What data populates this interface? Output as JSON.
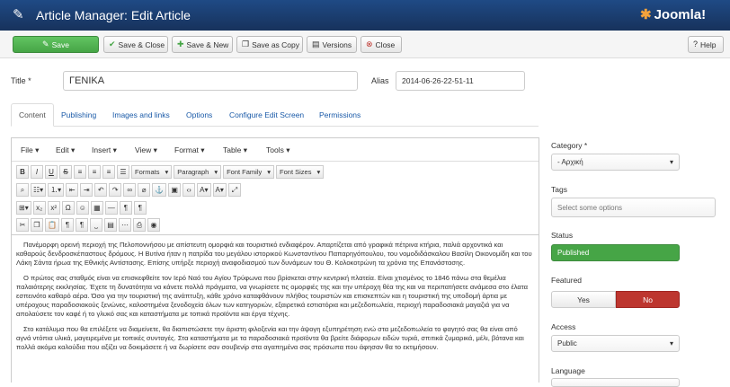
{
  "header": {
    "title": "Article Manager: Edit Article",
    "brand": "Joomla!"
  },
  "toolbar": {
    "save": "Save",
    "save_close": "Save & Close",
    "save_new": "Save & New",
    "save_copy": "Save as Copy",
    "versions": "Versions",
    "close": "Close",
    "help": "Help"
  },
  "form": {
    "title_label": "Title *",
    "title_value": "ΓΕΝΙΚΑ",
    "alias_label": "Alias",
    "alias_value": "2014-06-26-22-51-11"
  },
  "tabs": [
    "Content",
    "Publishing",
    "Images and links",
    "Options",
    "Configure Edit Screen",
    "Permissions"
  ],
  "editor": {
    "menus": [
      "File",
      "Edit",
      "Insert",
      "View",
      "Format",
      "Table",
      "Tools"
    ],
    "formats": "Formats",
    "paragraph": "Paragraph",
    "font_family": "Font Family",
    "font_sizes": "Font Sizes",
    "paragraphs": [
      "Πανέμορφη ορεινή περιοχή της Πελοποννήσου με απίστευτη ομορφιά και τουριστικό ενδιαφέρον. Απαρτίζεται από γραφικά πέτρινα κτήρια, παλιά αρχοντικά και καθαρούς δενδροσκέπαστους δρόμους. Η Βυτίνα ήταν η πατρίδα του μεγάλου ιστορικού Κωνσταντίνου Παπαρηγόπουλου, του νομοδιδάσκαλου Βασίλη Οικονομίδη και του Λάκη Σάντα ήρωα της Εθνικής Αντίστασης. Επίσης υπήρξε περιοχή αναφοδιασμού των δυνάμεων του Θ. Κολοκοτρώνη τα χρόνια της Επανάστασης.",
      "Ο πρώτος σας σταθμός είναι να επισκεφθείτε τον Ιερό Ναό του Αγίου Τρύφωνα που βρίσκεται στην κεντρική πλατεία. Είναι χτισμένος το 1846 πάνω στα θεμέλια παλαιότερης εκκλησίας. Έχετε τη δυνατότητα να κάνετε πολλά πράγματα, να γνωρίσετε τις ομορφιές της και την υπέροχη θέα της και να περιπατήσετε ανάμεσα στο έλατα εσπεινότο καθαρό αέρα. Όσο για την τουριστική της ανάπτυξη, κάθε χρόνο καταφθάνουν πλήθος τουριστών και επισκεπτών και η τουριστική της υποδομή άρτια με υπέροχους παραδοσιακούς ξενώνες, καλοστημένα ξενοδοχεία όλων των κατηγοριών, εξαιρετικά εστιατόρια και μεζεδοπωλεία, περιοχή παραδοσιακά μαγαζιά για να απολαύσετε τον καφέ ή το γλυκό σας και καταστήματα με τοπικά προϊόντα και έργα τέχνης.",
      "Στο κατάλυμα που θα επιλέξετε να διαμείνετε, θα διαπιστώσετε την άριστη φιλοξενία και την άψογη εξυπηρέτηση ενώ στα μεζεδοπωλεία το φαγητό σας θα είναι από αγνά ντόπια υλικά, μαγειρεμένα με τοπικές συνταγές. Στα καταστήματα με τα παραδοσιακά προϊόντα θα βρείτε διάφορων ειδών τυριά, σπιτικά ζυμαρικά, μέλι, βότανα και πολλά ακόμα καλούδια που αξίζει να δοκιμάσετε ή να δωρίσετε σαν σουβενίρ στα αγαπημένα σας πρόσωπα που άφησαν θα το εκτιμήσουν."
    ]
  },
  "sidebar": {
    "category_label": "Category *",
    "category_value": "- Αρχική",
    "tags_label": "Tags",
    "tags_placeholder": "Select some options",
    "status_label": "Status",
    "status_value": "Published",
    "featured_label": "Featured",
    "featured_yes": "Yes",
    "featured_no": "No",
    "access_label": "Access",
    "access_value": "Public",
    "language_label": "Language"
  },
  "colors": {
    "header": "#1a3867",
    "save": "#46a546",
    "published": "#46a546",
    "no_active": "#bd362f",
    "link": "#1a5aa8"
  }
}
